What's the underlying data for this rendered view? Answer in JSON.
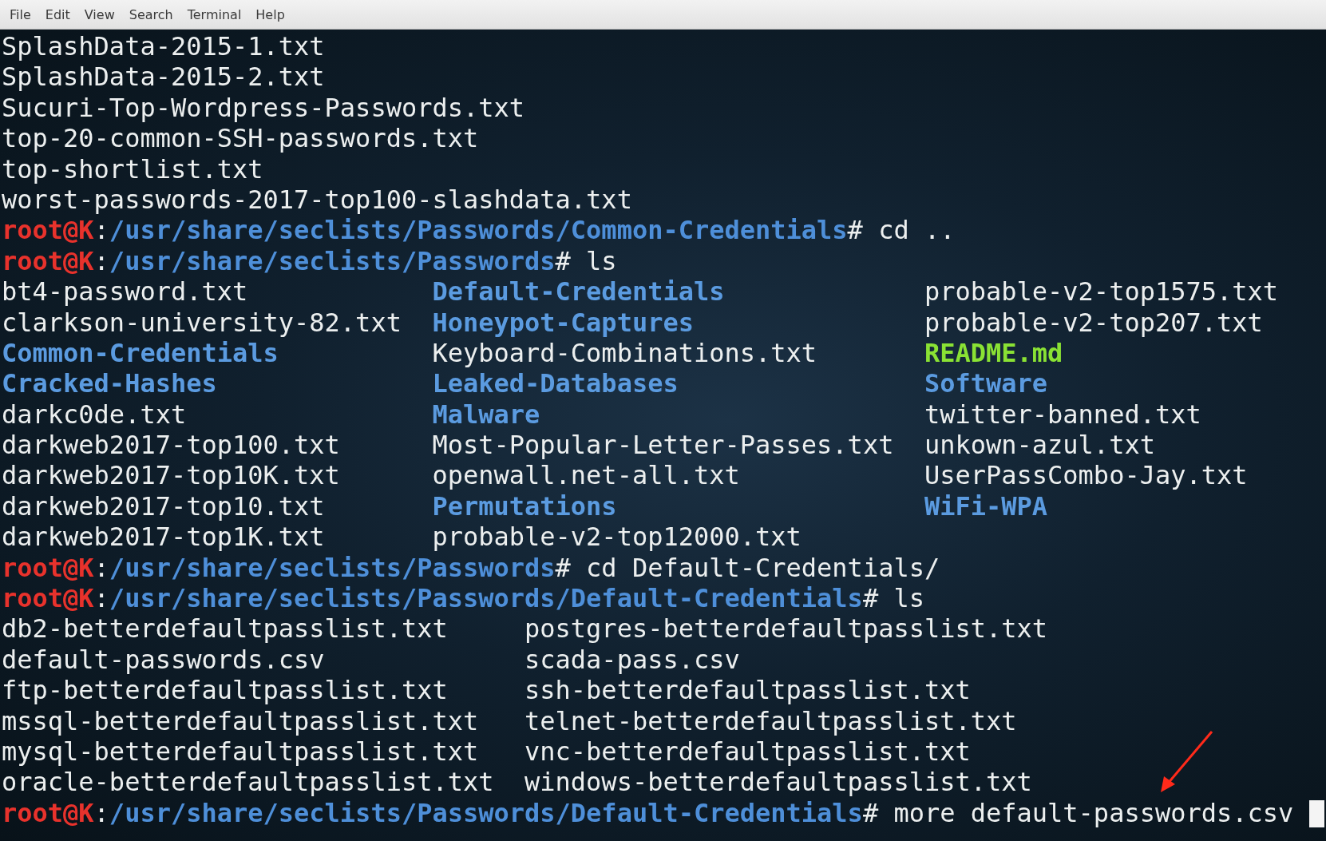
{
  "menu_bar": {
    "items": [
      "File",
      "Edit",
      "View",
      "Search",
      "Terminal",
      "Help"
    ]
  },
  "terminal": {
    "lines": [
      {
        "kind": "output",
        "text": "SplashData-2015-1.txt"
      },
      {
        "kind": "output",
        "text": "SplashData-2015-2.txt"
      },
      {
        "kind": "output",
        "text": "Sucuri-Top-Wordpress-Passwords.txt"
      },
      {
        "kind": "output",
        "text": "top-20-common-SSH-passwords.txt"
      },
      {
        "kind": "output",
        "text": "top-shortlist.txt"
      },
      {
        "kind": "output",
        "text": "worst-passwords-2017-top100-slashdata.txt"
      },
      {
        "kind": "prompt",
        "user": "root@K",
        "colon": ":",
        "path": "/usr/share/seclists/Passwords/Common-Credentials",
        "prompt_char": "#",
        "command": "cd ..",
        "cursor": false
      },
      {
        "kind": "prompt",
        "user": "root@K",
        "colon": ":",
        "path": "/usr/share/seclists/Passwords",
        "prompt_char": "#",
        "command": "ls",
        "cursor": false
      },
      {
        "kind": "listing",
        "columns": [
          [
            {
              "name": "bt4-password.txt",
              "kind": "file"
            },
            {
              "name": "clarkson-university-82.txt",
              "kind": "file"
            },
            {
              "name": "Common-Credentials",
              "kind": "dir"
            },
            {
              "name": "Cracked-Hashes",
              "kind": "dir"
            },
            {
              "name": "darkc0de.txt",
              "kind": "file"
            },
            {
              "name": "darkweb2017-top100.txt",
              "kind": "file"
            },
            {
              "name": "darkweb2017-top10K.txt",
              "kind": "file"
            },
            {
              "name": "darkweb2017-top10.txt",
              "kind": "file"
            },
            {
              "name": "darkweb2017-top1K.txt",
              "kind": "file"
            }
          ],
          [
            {
              "name": "Default-Credentials",
              "kind": "dir"
            },
            {
              "name": "Honeypot-Captures",
              "kind": "dir"
            },
            {
              "name": "Keyboard-Combinations.txt",
              "kind": "file"
            },
            {
              "name": "Leaked-Databases",
              "kind": "dir"
            },
            {
              "name": "Malware",
              "kind": "dir"
            },
            {
              "name": "Most-Popular-Letter-Passes.txt",
              "kind": "file"
            },
            {
              "name": "openwall.net-all.txt",
              "kind": "file"
            },
            {
              "name": "Permutations",
              "kind": "dir"
            },
            {
              "name": "probable-v2-top12000.txt",
              "kind": "file"
            }
          ],
          [
            {
              "name": "probable-v2-top1575.txt",
              "kind": "file"
            },
            {
              "name": "probable-v2-top207.txt",
              "kind": "file"
            },
            {
              "name": "README.md",
              "kind": "markdown"
            },
            {
              "name": "Software",
              "kind": "dir"
            },
            {
              "name": "twitter-banned.txt",
              "kind": "file"
            },
            {
              "name": "unkown-azul.txt",
              "kind": "file"
            },
            {
              "name": "UserPassCombo-Jay.txt",
              "kind": "file"
            },
            {
              "name": "WiFi-WPA",
              "kind": "dir"
            }
          ]
        ]
      },
      {
        "kind": "prompt",
        "user": "root@K",
        "colon": ":",
        "path": "/usr/share/seclists/Passwords",
        "prompt_char": "#",
        "command": "cd Default-Credentials/",
        "cursor": false
      },
      {
        "kind": "prompt",
        "user": "root@K",
        "colon": ":",
        "path": "/usr/share/seclists/Passwords/Default-Credentials",
        "prompt_char": "#",
        "command": "ls",
        "cursor": false
      },
      {
        "kind": "listing",
        "columns": [
          [
            {
              "name": "db2-betterdefaultpasslist.txt",
              "kind": "file"
            },
            {
              "name": "default-passwords.csv",
              "kind": "file"
            },
            {
              "name": "ftp-betterdefaultpasslist.txt",
              "kind": "file"
            },
            {
              "name": "mssql-betterdefaultpasslist.txt",
              "kind": "file"
            },
            {
              "name": "mysql-betterdefaultpasslist.txt",
              "kind": "file"
            },
            {
              "name": "oracle-betterdefaultpasslist.txt",
              "kind": "file"
            }
          ],
          [
            {
              "name": "postgres-betterdefaultpasslist.txt",
              "kind": "file"
            },
            {
              "name": "scada-pass.csv",
              "kind": "file"
            },
            {
              "name": "ssh-betterdefaultpasslist.txt",
              "kind": "file"
            },
            {
              "name": "telnet-betterdefaultpasslist.txt",
              "kind": "file"
            },
            {
              "name": "vnc-betterdefaultpasslist.txt",
              "kind": "file"
            },
            {
              "name": "windows-betterdefaultpasslist.txt",
              "kind": "file"
            }
          ]
        ]
      },
      {
        "kind": "prompt",
        "user": "root@K",
        "colon": ":",
        "path": "/usr/share/seclists/Passwords/Default-Credentials",
        "prompt_char": "#",
        "command": "more default-passwords.csv",
        "cursor": true
      }
    ]
  }
}
